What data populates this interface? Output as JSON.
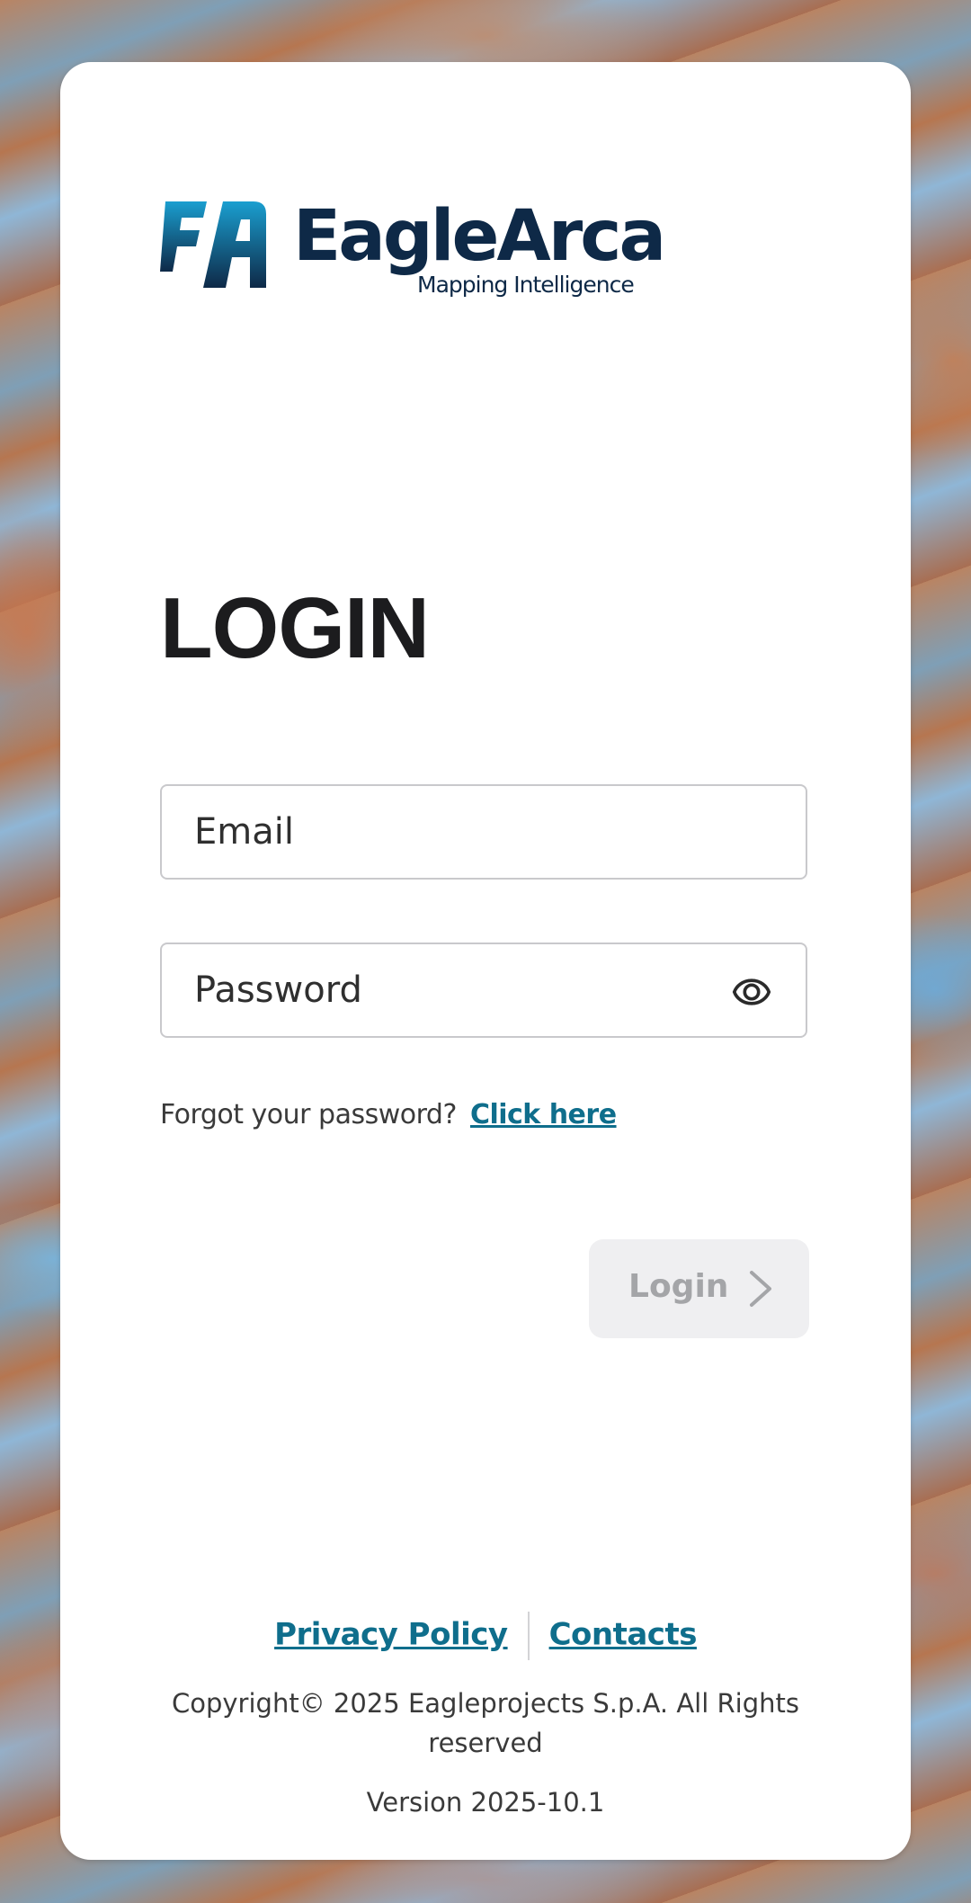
{
  "brand": {
    "name": "EagleArca",
    "tagline": "Mapping Intelligence",
    "colors": {
      "dark": "#0e2947",
      "accent": "#1497c6"
    }
  },
  "login": {
    "title": "LOGIN",
    "email_placeholder": "Email",
    "password_placeholder": "Password",
    "password_toggle_icon": "eye-icon",
    "forgot_text": "Forgot your password?",
    "forgot_link": "Click here",
    "submit_label": "Login",
    "submit_icon": "chevron-right-icon",
    "submit_enabled": false
  },
  "footer": {
    "privacy_label": "Privacy Policy",
    "contacts_label": "Contacts",
    "copyright_line1": "Copyright© 2025 Eagleprojects S.p.A. All Rights",
    "copyright_line2": "reserved",
    "version": "Version 2025-10.1"
  },
  "colors": {
    "link": "#0f6e8c",
    "button_disabled_bg": "#efeff1",
    "button_disabled_text": "#a4a5a8"
  }
}
